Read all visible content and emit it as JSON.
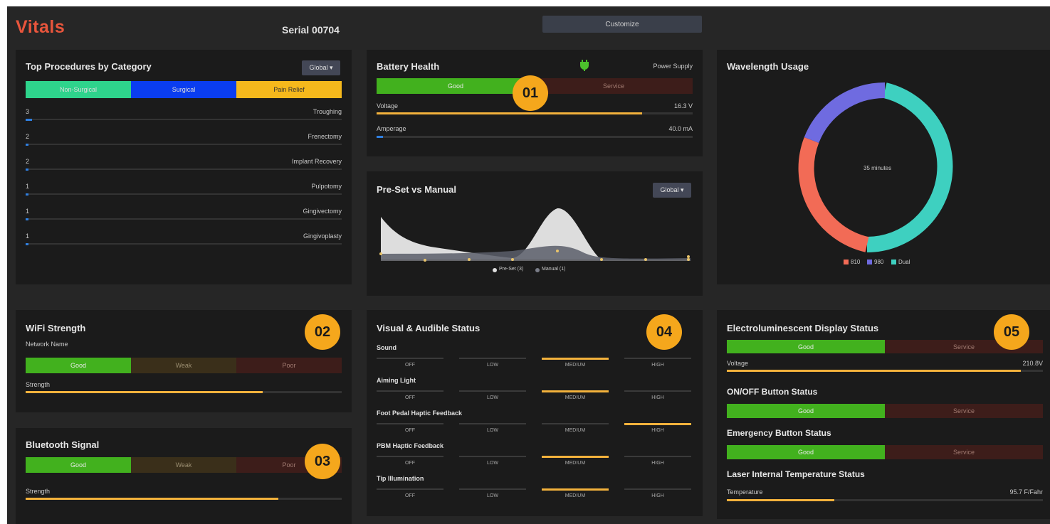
{
  "header": {
    "title": "Vitals",
    "serial": "Serial 00704",
    "customize_label": "Customize"
  },
  "top_procedures": {
    "title": "Top Procedures by Category",
    "filter_label": "Global ▾",
    "tabs": [
      "Non-Surgical",
      "Surgical",
      "Pain Relief"
    ],
    "tab_colors": [
      "#2ed48c",
      "#0a3df0",
      "#f5b81c"
    ],
    "items": [
      {
        "count": "3",
        "name": "Troughing",
        "fraction": 0.02
      },
      {
        "count": "2",
        "name": "Frenectomy",
        "fraction": 0.01
      },
      {
        "count": "2",
        "name": "Implant Recovery",
        "fraction": 0.01
      },
      {
        "count": "1",
        "name": "Pulpotomy",
        "fraction": 0.005
      },
      {
        "count": "1",
        "name": "Gingivectomy",
        "fraction": 0.005
      },
      {
        "count": "1",
        "name": "Gingivoplasty",
        "fraction": 0.005
      }
    ]
  },
  "battery": {
    "title": "Battery Health",
    "power_label": "Power Supply",
    "good": "Good",
    "service": "Service",
    "voltage_label": "Voltage",
    "voltage_value": "16.3 V",
    "voltage_fraction": 0.84,
    "amperage_label": "Amperage",
    "amperage_value": "40.0 mA",
    "amperage_fraction": 0.02
  },
  "preset": {
    "title": "Pre-Set vs Manual",
    "filter_label": "Global ▾",
    "legend": [
      "Pre-Set (3)",
      "Manual (1)"
    ]
  },
  "wavelength": {
    "title": "Wavelength Usage",
    "center_label": "35 minutes",
    "legend": [
      {
        "name": "810",
        "color": "#f26b56"
      },
      {
        "name": "980",
        "color": "#6f6be0"
      },
      {
        "name": "Dual",
        "color": "#3ed0c0"
      }
    ]
  },
  "wifi": {
    "title": "WiFi Strength",
    "network_label": "Network Name",
    "good": "Good",
    "weak": "Weak",
    "poor": "Poor",
    "strength_label": "Strength",
    "strength_fraction": 0.75
  },
  "bluetooth": {
    "title": "Bluetooth Signal",
    "good": "Good",
    "weak": "Weak",
    "poor": "Poor",
    "strength_label": "Strength",
    "strength_fraction": 0.8
  },
  "visual": {
    "title": "Visual & Audible Status",
    "levels": [
      "OFF",
      "LOW",
      "MEDIUM",
      "HIGH"
    ],
    "rows": [
      {
        "label": "Sound",
        "level": 2
      },
      {
        "label": "Aiming Light",
        "level": 2
      },
      {
        "label": "Foot Pedal Haptic Feedback",
        "level": 3
      },
      {
        "label": "PBM Haptic Feedback",
        "level": 2
      },
      {
        "label": "Tip Illumination",
        "level": 2
      }
    ]
  },
  "el_display": {
    "title": "Electroluminescent Display Status",
    "good": "Good",
    "service": "Service",
    "voltage_label": "Voltage",
    "voltage_value": "210.8V",
    "voltage_fraction": 0.93,
    "onoff_title": "ON/OFF Button Status",
    "emergency_title": "Emergency Button Status",
    "laser_title": "Laser Internal Temperature Status",
    "temp_label": "Temperature",
    "temp_value": "95.7 F/Fahr",
    "temp_fraction": 0.34
  },
  "badges": [
    "01",
    "02",
    "03",
    "04",
    "05"
  ]
}
